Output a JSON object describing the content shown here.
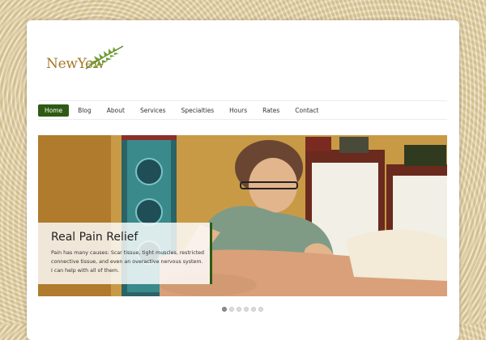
{
  "logo": {
    "text": "NewYew"
  },
  "nav": {
    "items": [
      {
        "label": "Home"
      },
      {
        "label": "Blog"
      },
      {
        "label": "About"
      },
      {
        "label": "Services"
      },
      {
        "label": "Specialties"
      },
      {
        "label": "Hours"
      },
      {
        "label": "Rates"
      },
      {
        "label": "Contact"
      }
    ],
    "active_index": 0
  },
  "slider": {
    "title": "Real Pain Relief",
    "body": "Pain has many causes: Scar tissue, tight muscles, restricted connective tissue, and even an overactive nervous system. I can help with all of them.",
    "slide_count": 6,
    "active_slide": 1
  },
  "colors": {
    "accent": "#2e5a13",
    "logo": "#a5782a"
  }
}
